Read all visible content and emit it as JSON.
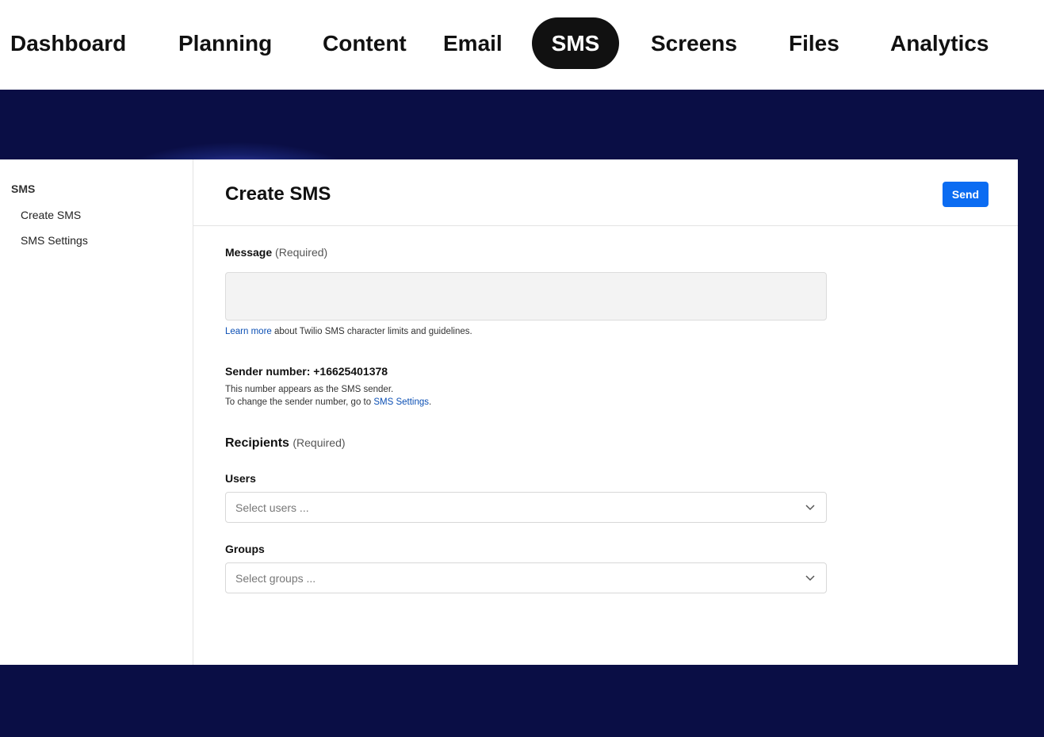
{
  "nav": {
    "items": [
      "Dashboard",
      "Planning",
      "Content",
      "Email",
      "SMS",
      "Screens",
      "Files",
      "Analytics"
    ],
    "active": "SMS"
  },
  "sidebar": {
    "heading": "SMS",
    "items": [
      "Create SMS",
      "SMS Settings"
    ]
  },
  "main": {
    "title": "Create SMS",
    "send_label": "Send",
    "message": {
      "label": "Message",
      "required": "(Required)",
      "value": "",
      "help_link": "Learn more",
      "help_text": " about Twilio SMS character limits and guidelines."
    },
    "sender": {
      "label": "Sender number: +16625401378",
      "line1": "This number appears as the SMS sender.",
      "line2_prefix": "To change the sender number, go to ",
      "line2_link": "SMS Settings",
      "line2_suffix": "."
    },
    "recipients": {
      "label": "Recipients",
      "required": "(Required)",
      "users_label": "Users",
      "users_placeholder": "Select users ...",
      "groups_label": "Groups",
      "groups_placeholder": "Select groups ..."
    }
  },
  "colors": {
    "accent": "#0b6cf2",
    "background": "#0a0e45",
    "link": "#0b4fb4"
  }
}
